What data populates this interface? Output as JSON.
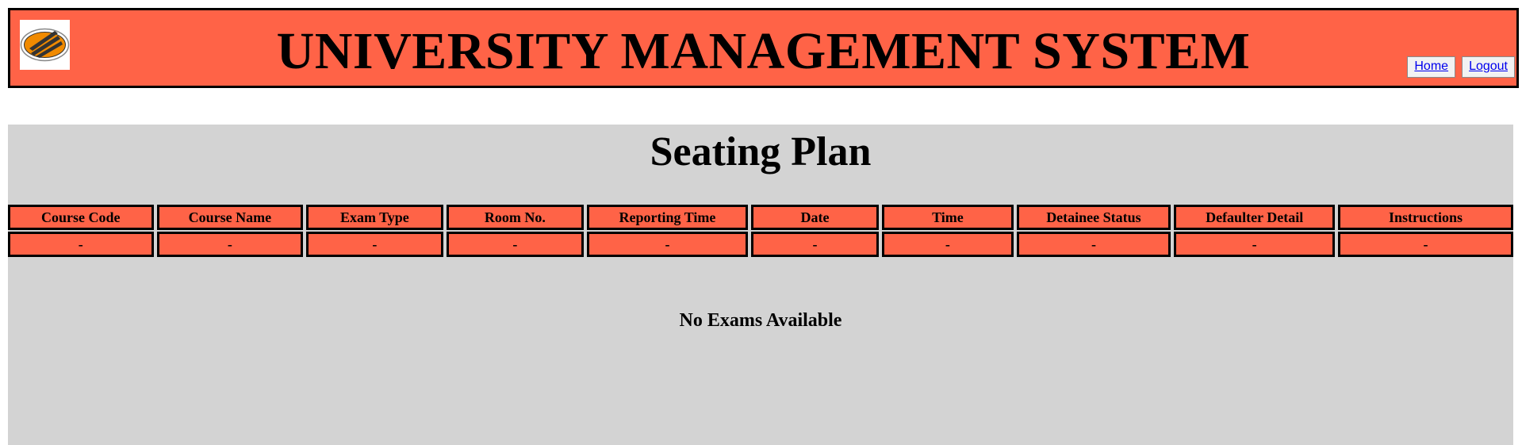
{
  "header": {
    "title": "UNIVERSITY MANAGEMENT SYSTEM",
    "nav": {
      "home_label": "Home",
      "logout_label": "Logout"
    }
  },
  "main": {
    "title": "Seating Plan",
    "table": {
      "columns": [
        "Course Code",
        "Course Name",
        "Exam Type",
        "Room No.",
        "Reporting Time",
        "Date",
        "Time",
        "Detainee Status",
        "Defaulter Detail",
        "Instructions"
      ],
      "rows": [
        [
          "-",
          "-",
          "-",
          "-",
          "-",
          "-",
          "-",
          "-",
          "-",
          "-"
        ]
      ]
    },
    "empty_message": "No Exams Available"
  },
  "colors": {
    "accent": "#ff6347",
    "panel": "#d3d3d3",
    "logo_orange": "#f08a00"
  }
}
